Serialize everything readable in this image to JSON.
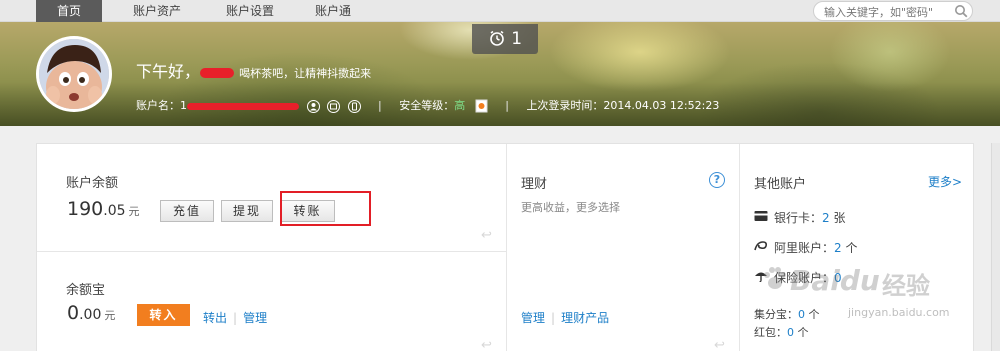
{
  "nav": {
    "items": [
      {
        "label": "首页",
        "active": true
      },
      {
        "label": "账户资产",
        "active": false
      },
      {
        "label": "账户设置",
        "active": false
      },
      {
        "label": "账户通",
        "active": false
      }
    ],
    "search_placeholder": "输入关键字，如\"密码\""
  },
  "banner": {
    "notification_count": "1",
    "greeting": "下午好，",
    "greeting_tip": "喝杯茶吧，让精神抖擞起来",
    "account_label": "账户名：1",
    "security_label": "安全等级：",
    "security_value": "高",
    "last_login": "上次登录时间：2014.04.03 12:52:23"
  },
  "balance": {
    "title": "账户余额",
    "amount_int": "190",
    "amount_dec": ".05",
    "unit": "元",
    "recharge_label": "充值",
    "withdraw_label": "提现",
    "transfer_label": "转账"
  },
  "yuebao": {
    "title": "余额宝",
    "amount_int": "0",
    "amount_dec": ".00",
    "unit": "元",
    "transfer_in_label": "转入",
    "transfer_out_label": "转出",
    "manage_label": "管理"
  },
  "licai": {
    "title": "理财",
    "subtitle": "更高收益，更多选择",
    "manage_label": "管理",
    "products_label": "理财产品"
  },
  "other_accounts": {
    "title": "其他账户",
    "more_label": "更多>",
    "bank_card_label": "银行卡：",
    "bank_card_count": "2",
    "bank_card_unit": "张",
    "ali_label": "阿里账户：",
    "ali_count": "2",
    "ali_unit": "个",
    "insurance_label": "保险账户：",
    "insurance_count": "0",
    "jifen_label": "集分宝：",
    "jifen_count": "0",
    "jifen_unit": "个",
    "hongbao_label": "红包：",
    "hongbao_count": "0",
    "hongbao_unit": "个"
  },
  "watermark": {
    "brand": "Baidu",
    "brand_cn": "经验",
    "url": "jingyan.baidu.com"
  },
  "colors": {
    "accent_orange": "#f27e1f",
    "link_blue": "#1e7fc8",
    "highlight_red": "#e21e26",
    "security_green": "#7fe08a"
  }
}
